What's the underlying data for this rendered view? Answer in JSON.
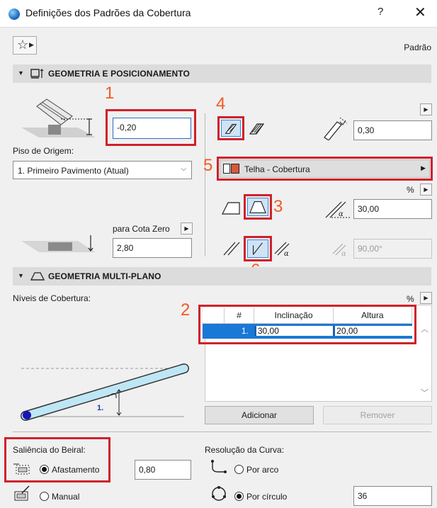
{
  "window": {
    "title": "Definições dos Padrões da Cobertura",
    "help": "?",
    "close": "✕"
  },
  "toolbar": {
    "favorites_icon": "star-icon",
    "preset_label": "Padrão"
  },
  "section1": {
    "label": "GEOMETRIA E POSICIONAMENTO",
    "height_value": "-0,20",
    "story_label": "Piso de Origem:",
    "story_value": "1. Primeiro Pavimento (Atual)",
    "to_zero_label": "para Cota Zero",
    "to_zero_value": "2,80",
    "thickness_value": "0,30",
    "material": "Telha - Cobertura",
    "percent_label": "%",
    "pitch_value": "30,00",
    "angle_value": "90,00°"
  },
  "section2": {
    "label": "GEOMETRIA MULTI-PLANO",
    "levels_label": "Níveis de Cobertura:",
    "percent_label": "%",
    "table": {
      "headers": [
        "#",
        "Inclinação",
        "Altura"
      ],
      "rows": [
        [
          "1.",
          "30,00",
          "20,00"
        ]
      ]
    },
    "preview_level_label": "1.",
    "add_button": "Adicionar",
    "remove_button": "Remover"
  },
  "eaves": {
    "label": "Saliência do Beiral:",
    "offset_option": "Afastamento",
    "offset_value": "0,80",
    "manual_option": "Manual"
  },
  "curve": {
    "label": "Resolução da Curva:",
    "by_arc": "Por arco",
    "by_circle": "Por círculo",
    "circle_value": "36"
  },
  "callouts": [
    "1",
    "2",
    "3",
    "4",
    "5",
    "6"
  ],
  "colors": {
    "callout": "#f15a22",
    "highlight_box": "#d0212b",
    "selection": "#1a78d6"
  }
}
